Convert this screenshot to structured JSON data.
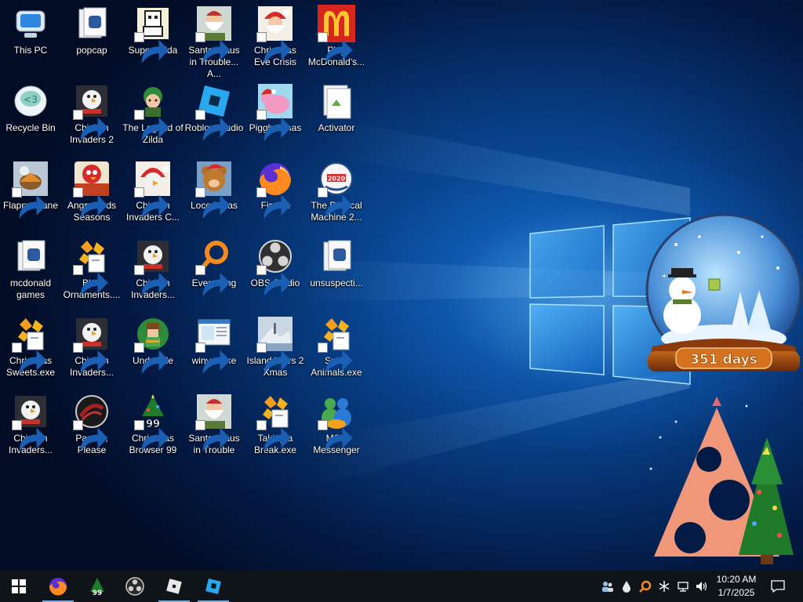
{
  "desktop": {
    "icons": [
      {
        "label": "This PC",
        "icon": "this-pc-icon"
      },
      {
        "label": "popcap",
        "icon": "folder-icon"
      },
      {
        "label": "Super Hilda",
        "icon": "super-hilda-icon"
      },
      {
        "label": "Santa Claus in Trouble... A...",
        "icon": "santa-claus-icon"
      },
      {
        "label": "Christmas Eve Crisis",
        "icon": "santa-face-icon"
      },
      {
        "label": "Play McDonald's...",
        "icon": "mcdonalds-icon"
      },
      {
        "label": "Recycle Bin",
        "icon": "recycle-bin-icon"
      },
      {
        "label": "Chicken Invaders 2",
        "icon": "chicken-invaders-icon"
      },
      {
        "label": "The Legend of Zilda",
        "icon": "legend-of-zilda-icon"
      },
      {
        "label": "Roblox Studio",
        "icon": "roblox-studio-icon"
      },
      {
        "label": "Piggly Xmas",
        "icon": "piggly-xmas-icon"
      },
      {
        "label": "Activator",
        "icon": "file-icon"
      },
      {
        "label": "Flappy Plane",
        "icon": "flappy-plane-icon"
      },
      {
        "label": "Angry Birds Seasons",
        "icon": "angry-birds-icon"
      },
      {
        "label": "Chicken Invaders C...",
        "icon": "chicken-santa-icon"
      },
      {
        "label": "Loco Xmas",
        "icon": "teddy-bear-icon"
      },
      {
        "label": "Firefox",
        "icon": "firefox-icon"
      },
      {
        "label": "The Political Machine 2...",
        "icon": "political-machine-icon"
      },
      {
        "label": "mcdonald games",
        "icon": "folder-icon"
      },
      {
        "label": "Blue Ornaments....",
        "icon": "exe-icon"
      },
      {
        "label": "Chicken Invaders...",
        "icon": "chicken-invaders-icon"
      },
      {
        "label": "Everything",
        "icon": "everything-search-icon"
      },
      {
        "label": "OBS Studio",
        "icon": "obs-studio-icon"
      },
      {
        "label": "unsuspecti...",
        "icon": "folder-icon"
      },
      {
        "label": "Christmas Sweets.exe",
        "icon": "exe-icon"
      },
      {
        "label": "Chicken Invaders...",
        "icon": "chicken-invaders-icon"
      },
      {
        "label": "Undertale",
        "icon": "undertale-icon"
      },
      {
        "label": "winver.exe",
        "icon": "winver-icon"
      },
      {
        "label": "Island Wars 2 Xmas",
        "icon": "island-wars-icon"
      },
      {
        "label": "Snow Animals.exe",
        "icon": "exe-icon"
      },
      {
        "label": "Chicken Invaders...",
        "icon": "chicken-invaders-icon"
      },
      {
        "label": "Papers, Please",
        "icon": "papers-please-icon"
      },
      {
        "label": "Christmas Browser 99",
        "icon": "christmas-browser-icon"
      },
      {
        "label": "Santa Claus in Trouble",
        "icon": "santa-claus-icon"
      },
      {
        "label": "Taking a Break.exe",
        "icon": "exe-icon"
      },
      {
        "label": "MSN Messenger",
        "icon": "msn-messenger-icon"
      }
    ]
  },
  "widgets": {
    "countdown": "351 days"
  },
  "taskbar": {
    "items": [
      {
        "name": "start",
        "icon": "windows-start-icon"
      },
      {
        "name": "firefox",
        "icon": "firefox-icon",
        "active": true
      },
      {
        "name": "christmas-browser",
        "icon": "christmas-browser-icon",
        "label": "99"
      },
      {
        "name": "obs-studio",
        "icon": "obs-studio-icon"
      },
      {
        "name": "roblox",
        "icon": "roblox-icon",
        "active": true
      },
      {
        "name": "roblox-studio",
        "icon": "roblox-studio-icon",
        "active": true
      }
    ],
    "tray": {
      "icons": [
        "people-icon",
        "water-drop-icon",
        "search-everything-icon",
        "snowflake-icon",
        "network-icon",
        "volume-icon"
      ],
      "time": "10:20 AM",
      "date": "1/7/2025",
      "notification_icon": "action-center-icon"
    }
  },
  "colors": {
    "taskbar": "#0f1419",
    "accent": "#7aa8d8",
    "desktop": "#073f86"
  }
}
